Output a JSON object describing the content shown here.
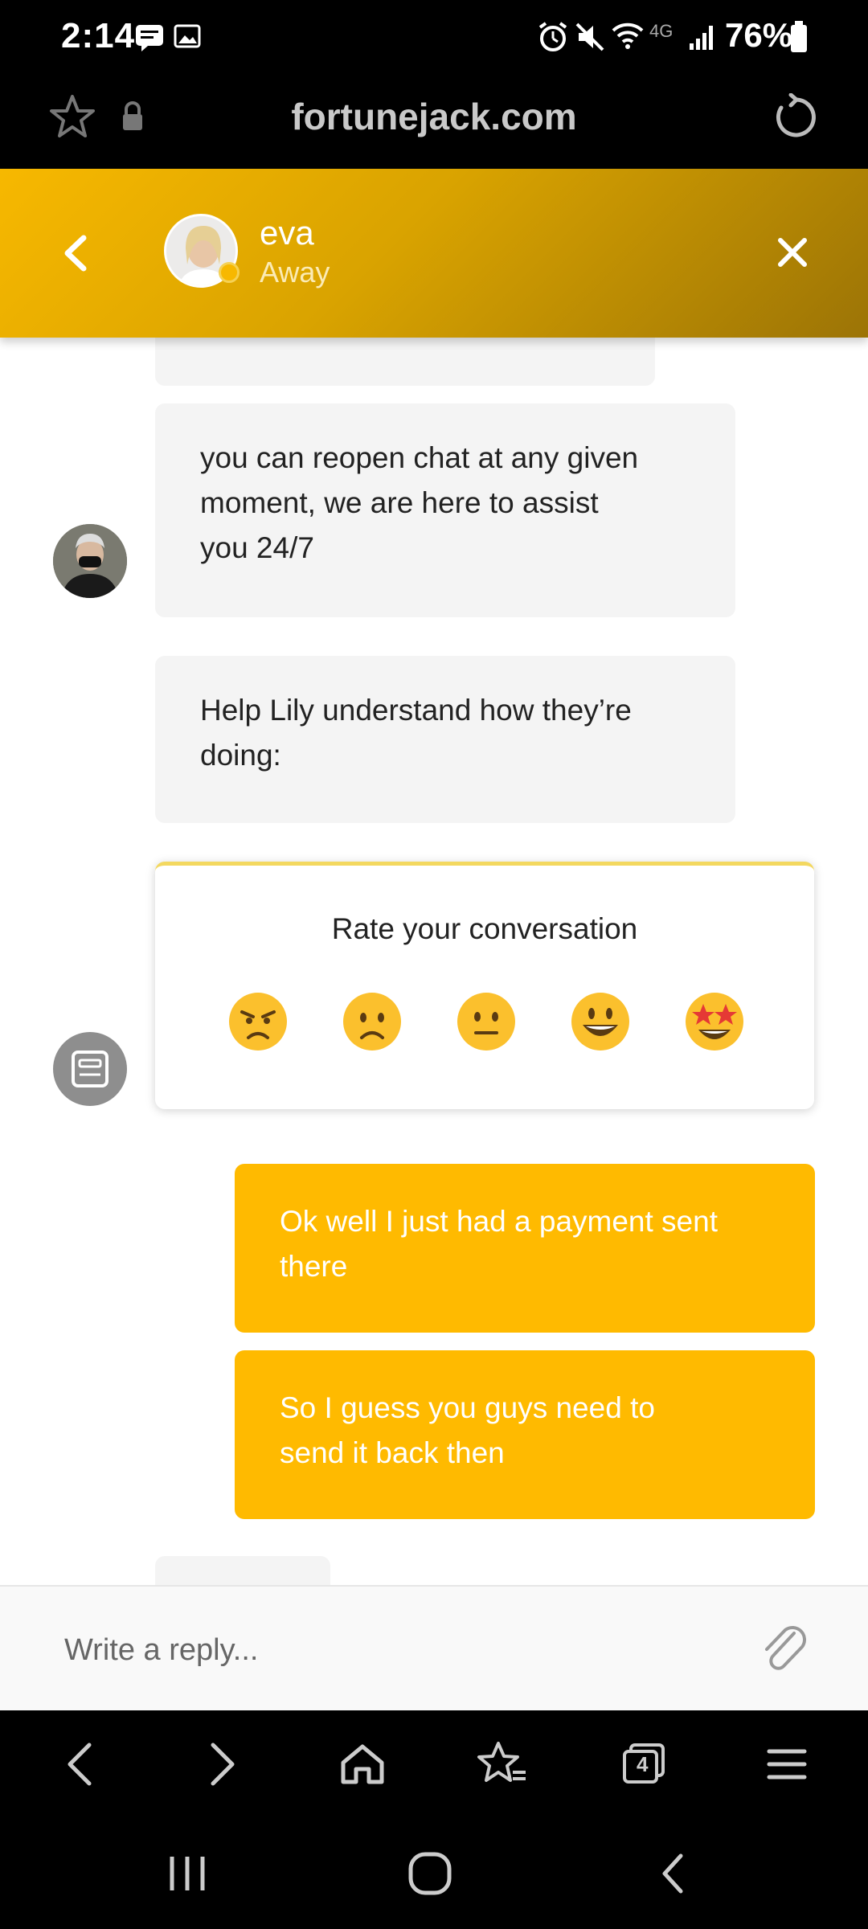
{
  "status_bar": {
    "time": "2:14",
    "network": "4G",
    "battery": "76%"
  },
  "browser": {
    "url": "fortunejack.com"
  },
  "chat_header": {
    "agent_name": "eva",
    "agent_status": "Away",
    "accent_color": "#f7b800"
  },
  "messages": {
    "agent_reopen": {
      "lines": [
        "you can reopen chat at any given",
        "moment, we are here to assist",
        "you 24/7"
      ]
    },
    "agent_help": {
      "lines": [
        "Help Lily understand how they’re",
        "doing:"
      ]
    },
    "user_1": {
      "lines": [
        "Ok well I just had a payment sent",
        "there"
      ]
    },
    "user_2": {
      "lines": [
        "So I guess you guys need to",
        "send it back then"
      ]
    }
  },
  "rating": {
    "title": "Rate your conversation",
    "options": [
      "angry-face",
      "frowning-face",
      "neutral-face",
      "smiling-face",
      "star-struck-face"
    ]
  },
  "composer": {
    "placeholder": "Write a reply..."
  },
  "toolbar": {
    "tabs_count": "4"
  },
  "colors": {
    "user_bubble": "#ffba00",
    "agent_bubble": "#f4f4f4"
  }
}
